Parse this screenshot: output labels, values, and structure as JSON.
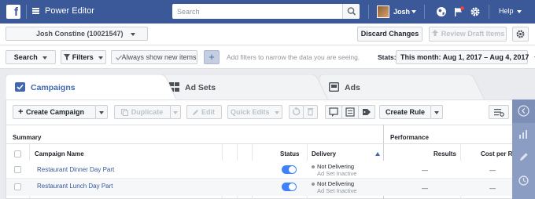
{
  "topbar": {
    "app_title": "Power Editor",
    "search_placeholder": "Search",
    "user_name": "Josh",
    "help_label": "Help",
    "icons": [
      "facebook-logo-icon",
      "menu-icon",
      "search-icon",
      "globe-icon",
      "flag-icon",
      "gear-icon"
    ]
  },
  "account": {
    "selected": "Josh Constine (10021547)",
    "discard_label": "Discard Changes",
    "review_label": "Review Draft Items"
  },
  "filters": {
    "search_label": "Search",
    "filters_label": "Filters",
    "show_new_label": "Always show new items",
    "add_label": "+",
    "hint": "Add filters to narrow the data you are seeing.",
    "stats_label": "Stats:",
    "date_range": "This month: Aug 1, 2017 – Aug 4, 2017"
  },
  "tabs": [
    {
      "label": "Campaigns",
      "active": true
    },
    {
      "label": "Ad Sets",
      "active": false
    },
    {
      "label": "Ads",
      "active": false
    }
  ],
  "toolbar": {
    "create_campaign": "Create Campaign",
    "duplicate": "Duplicate",
    "edit": "Edit",
    "quick_edits": "Quick Edits",
    "create_rule": "Create Rule"
  },
  "table": {
    "groups": {
      "summary": "Summary",
      "performance": "Performance"
    },
    "columns": {
      "name": "Campaign Name",
      "status": "Status",
      "delivery": "Delivery",
      "results": "Results",
      "cost": "Cost per Re"
    },
    "rows": [
      {
        "name": "Restaurant Dinner Day Part",
        "status_on": true,
        "delivery": "Not Delivering",
        "delivery_sub": "Ad Set Inactive",
        "results": "—",
        "cost": "—"
      },
      {
        "name": "Restaurant Lunch Day Part",
        "status_on": true,
        "delivery": "Not Delivering",
        "delivery_sub": "Ad Set Inactive",
        "results": "—",
        "cost": "—"
      }
    ]
  },
  "colors": {
    "brand": "#3b5998",
    "accent": "#4267b2",
    "toggle_on": "#4080ff"
  }
}
